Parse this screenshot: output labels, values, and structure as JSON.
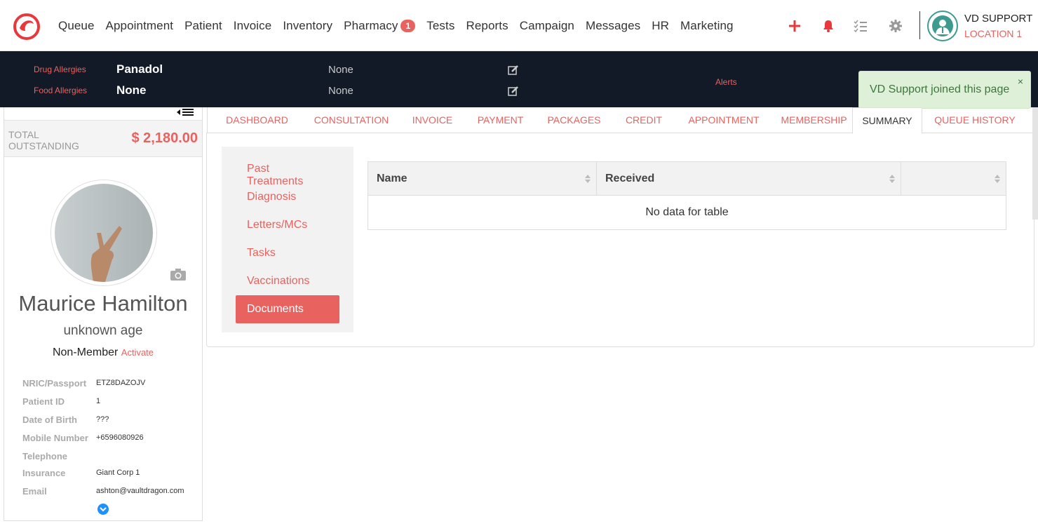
{
  "nav": {
    "items": [
      "Queue",
      "Appointment",
      "Patient",
      "Invoice",
      "Inventory",
      "Pharmacy",
      "Tests",
      "Reports",
      "Campaign",
      "Messages",
      "HR",
      "Marketing"
    ],
    "pharmacy_badge": "1"
  },
  "user": {
    "name": "VD SUPPORT",
    "location": "LOCATION 1"
  },
  "alerts": {
    "drug_label": "Drug Allergies",
    "drug_value": "Panadol",
    "drug_note": "None",
    "food_label": "Food Allergies",
    "food_value": "None",
    "food_note": "None",
    "alerts_label": "Alerts"
  },
  "toast": {
    "message": "VD Support joined this page",
    "close": "×"
  },
  "sidebar": {
    "outstanding_label": "TOTAL OUTSTANDING",
    "outstanding_value": "$ 2,180.00",
    "patient_name": "Maurice Hamilton",
    "age": "unknown age",
    "membership": "Non-Member",
    "activate": "Activate",
    "info": [
      {
        "k": "NRIC/Passport",
        "v": "ETZ8DAZOJV"
      },
      {
        "k": "Patient ID",
        "v": "1"
      },
      {
        "k": "Date of Birth",
        "v": "???"
      },
      {
        "k": "Mobile Number",
        "v": "+6596080926"
      },
      {
        "k": "Telephone",
        "v": ""
      },
      {
        "k": "Insurance",
        "v": "Giant Corp 1"
      },
      {
        "k": "Email",
        "v": "ashton@vaultdragon.com"
      }
    ]
  },
  "tabs": [
    "DASHBOARD",
    "CONSULTATION",
    "INVOICE",
    "PAYMENT",
    "PACKAGES",
    "CREDIT",
    "APPOINTMENT",
    "MEMBERSHIP",
    "SUMMARY",
    "QUEUE HISTORY"
  ],
  "active_tab": "SUMMARY",
  "subnav": [
    "Past Treatments",
    "Diagnosis",
    "Letters/MCs",
    "Tasks",
    "Vaccinations",
    "Documents"
  ],
  "active_subnav": "Documents",
  "table": {
    "columns": [
      "Name",
      "Received",
      ""
    ],
    "empty_text": "No data for table"
  },
  "colors": {
    "accent": "#e8625f",
    "dark": "#121a27",
    "teal": "#3d9a8e",
    "toast_bg": "#dff0d8"
  }
}
